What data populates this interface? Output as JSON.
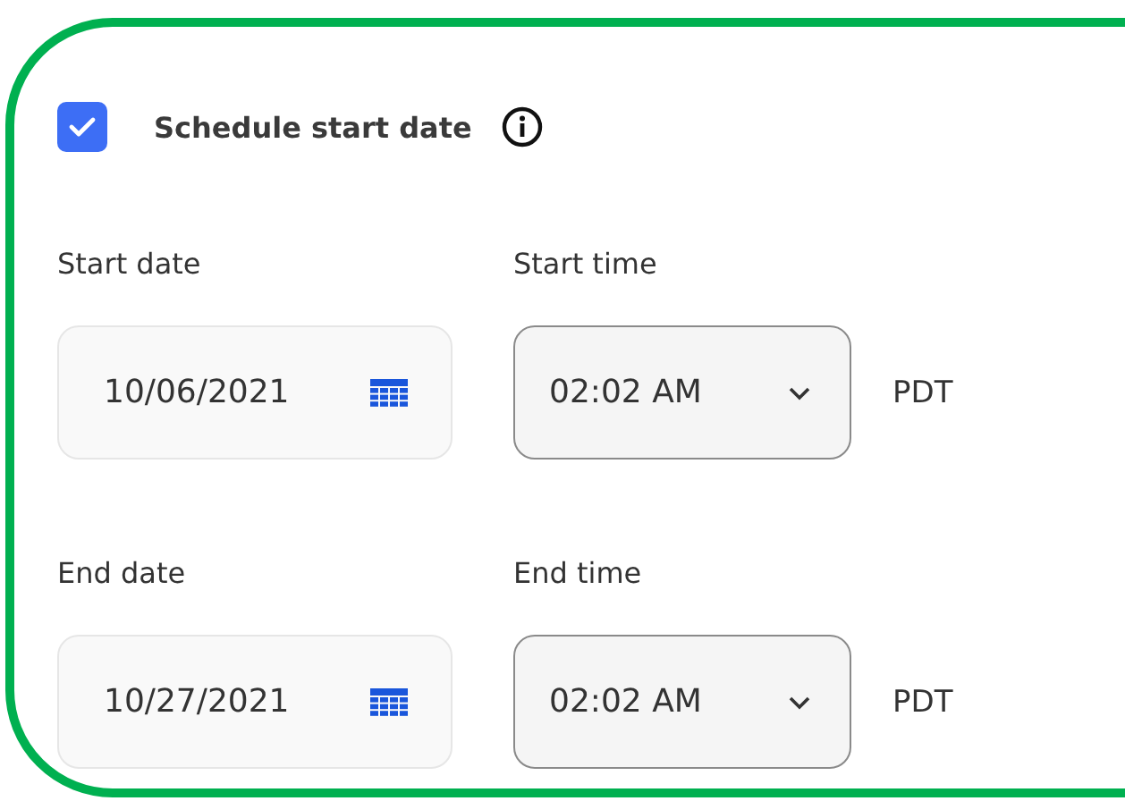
{
  "schedule": {
    "label": "Schedule start date",
    "checked": true
  },
  "rows": [
    {
      "date_label": "Start date",
      "date_value": "10/06/2021",
      "time_label": "Start time",
      "time_value": "02:02 AM",
      "timezone": "PDT"
    },
    {
      "date_label": "End date",
      "date_value": "10/27/2021",
      "time_label": "End time",
      "time_value": "02:02 AM",
      "timezone": "PDT"
    }
  ]
}
